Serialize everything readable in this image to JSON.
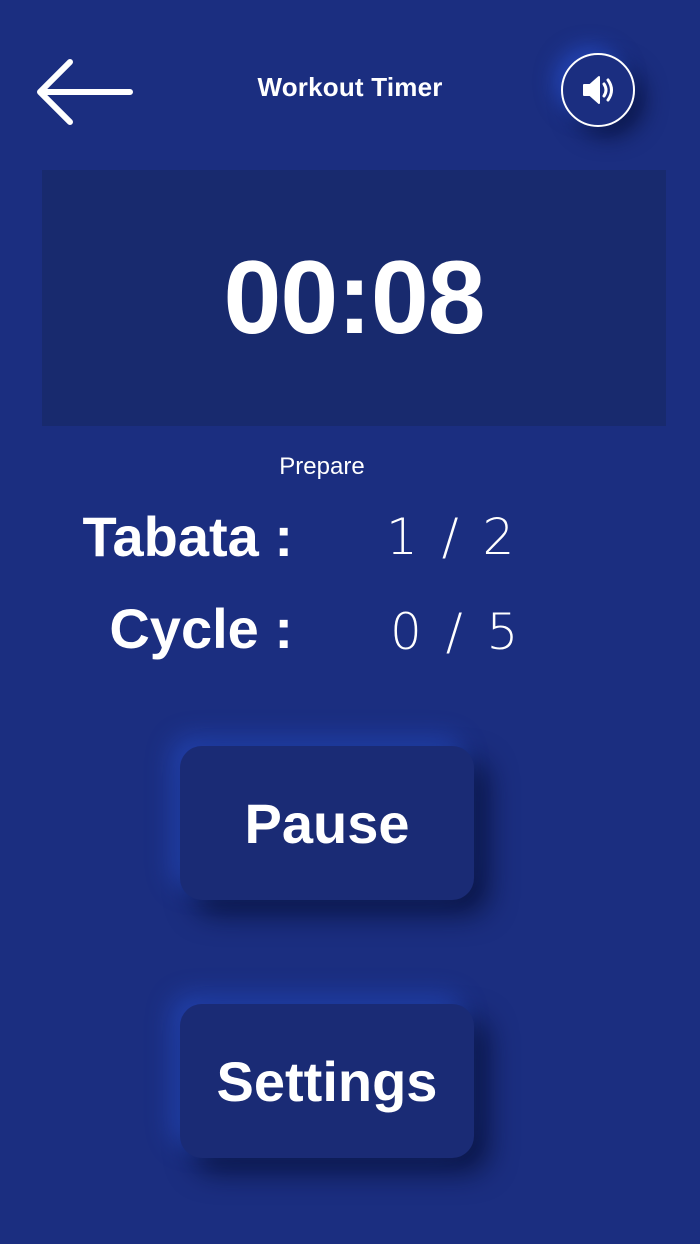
{
  "header": {
    "title": "Workout Timer",
    "back_icon": "arrow-left-icon",
    "sound_icon": "speaker-icon"
  },
  "timer": {
    "display": "00:08",
    "phase": "Prepare"
  },
  "stats": {
    "tabata_label": "Tabata :",
    "tabata_value": "1 / 2",
    "cycle_label": "Cycle :",
    "cycle_value": "0 / 5"
  },
  "actions": {
    "pause_label": "Pause",
    "settings_label": "Settings"
  },
  "colors": {
    "background": "#1b2e80",
    "panel": "#182a6e",
    "button": "#1a2b75",
    "text": "#ffffff"
  }
}
